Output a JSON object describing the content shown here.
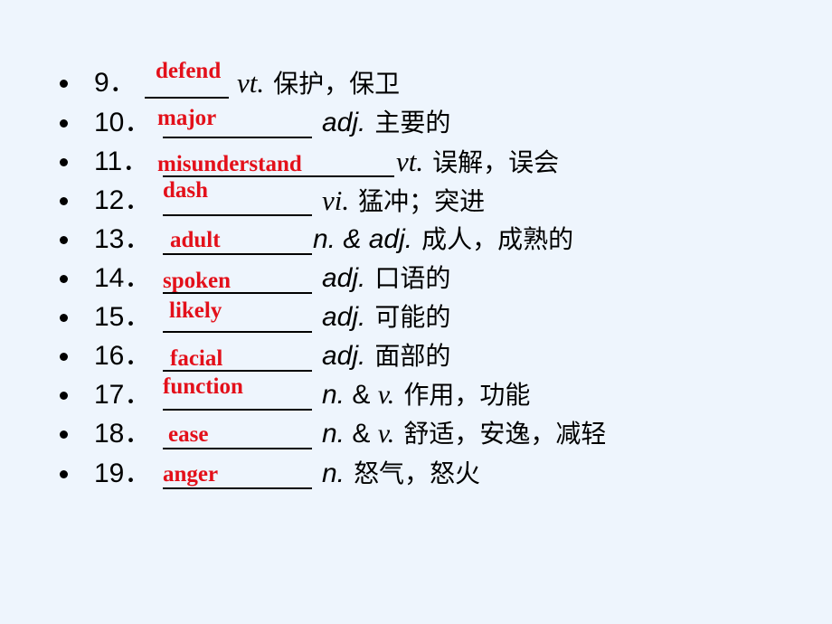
{
  "slide": {
    "background_color": "#eef5fd",
    "answer_color": "#e3101a",
    "items": [
      {
        "number": "9．",
        "answer": "defend",
        "pos": "vt.",
        "pos_style": "serif",
        "meaning": "保护，保卫"
      },
      {
        "number": "10．",
        "answer": "major",
        "pos": "adj.",
        "pos_style": "sans",
        "meaning": "主要的"
      },
      {
        "number": "11．",
        "answer": "misunderstand",
        "pos": "vt.",
        "pos_style": "serif",
        "meaning": "误解，误会"
      },
      {
        "number": "12．",
        "answer": "dash",
        "pos": "vi.",
        "pos_style": "serif",
        "meaning": "猛冲；突进"
      },
      {
        "number": "13．",
        "answer": "adult",
        "pos": "n. & adj.",
        "pos_style": "sans",
        "meaning": "成人，成熟的"
      },
      {
        "number": "14．",
        "answer": "spoken",
        "pos": "adj.",
        "pos_style": "sans",
        "meaning": "口语的"
      },
      {
        "number": "15．",
        "answer": "likely",
        "pos": "adj.",
        "pos_style": "sans",
        "meaning": "可能的"
      },
      {
        "number": "16．",
        "answer": "facial",
        "pos": "adj.",
        "pos_style": "sans",
        "meaning": "面部的"
      },
      {
        "number": "17．",
        "answer": "function",
        "pos": "n. & v.",
        "pos_style": "mixed",
        "meaning": "作用，功能"
      },
      {
        "number": "18．",
        "answer": "ease",
        "pos": "n. & v.",
        "pos_style": "mixed",
        "meaning": "舒适，安逸，减轻"
      },
      {
        "number": "19．",
        "answer": "anger",
        "pos": "n.",
        "pos_style": "sans",
        "meaning": "怒气，怒火"
      }
    ]
  }
}
